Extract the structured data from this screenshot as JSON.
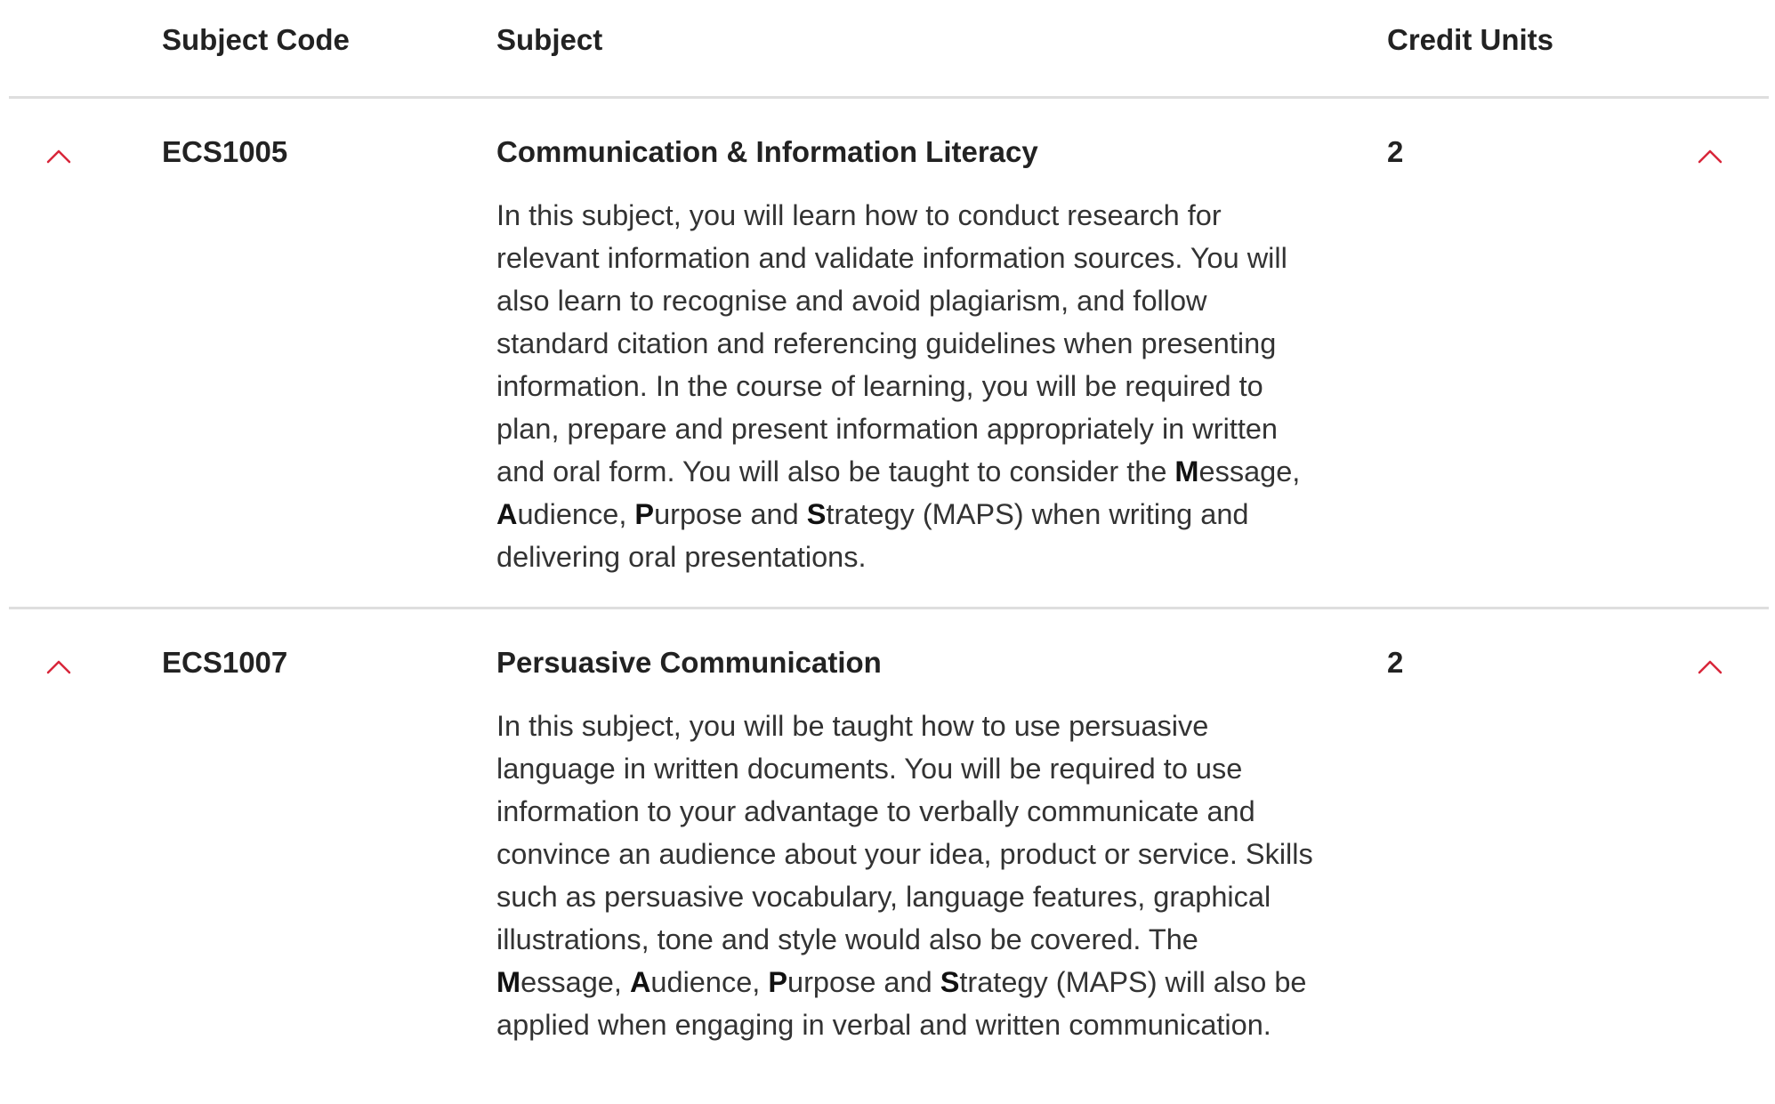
{
  "table": {
    "headers": {
      "code": "Subject Code",
      "subject": "Subject",
      "credits": "Credit Units"
    },
    "rows": [
      {
        "code": "ECS1005",
        "title": "Communication & Information Literacy",
        "credits": "2",
        "description": {
          "part1": "In this subject, you will learn how to conduct research for relevant information and validate information sources. You will also learn to recognise and avoid plagiarism, and follow standard citation and referencing guidelines when presenting information. In the course of learning, you will be required to plan, prepare and present information appropriately in written and oral form. You will also be taught to consider the ",
          "m_bold": "M",
          "m_rest": "essage, ",
          "a_bold": "A",
          "a_rest": "udience, ",
          "p_bold": "P",
          "p_rest": "urpose and ",
          "s_bold": "S",
          "s_rest": "trategy (MAPS) when writing and delivering oral presentations."
        },
        "expand_icon": "chevron-up-icon",
        "accent_color": "#d8263a"
      },
      {
        "code": "ECS1007",
        "title": "Persuasive Communication",
        "credits": "2",
        "description": {
          "part1": "In this subject, you will be taught how to use persuasive language in written documents. You will be required to use information to your advantage to verbally communicate and convince an audience about your idea, product or service. Skills such as persuasive vocabulary, language features, graphical illustrations, tone and style would also be covered. The ",
          "m_bold": "M",
          "m_rest": "essage, ",
          "a_bold": "A",
          "a_rest": "udience, ",
          "p_bold": "P",
          "p_rest": "urpose and ",
          "s_bold": "S",
          "s_rest": "trategy (MAPS) will also be applied when engaging in verbal and written communication."
        },
        "expand_icon": "chevron-up-icon",
        "accent_color": "#d8263a"
      }
    ]
  }
}
